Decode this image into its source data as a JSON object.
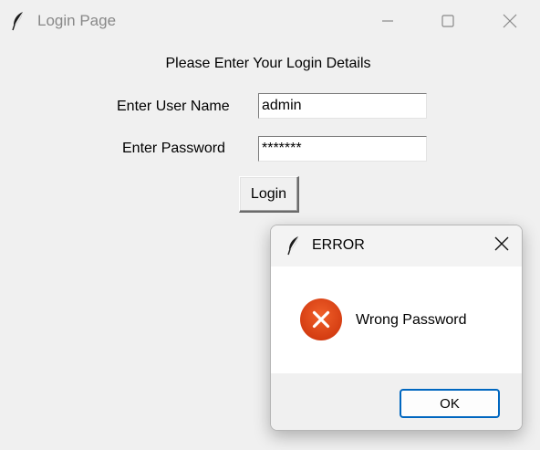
{
  "window": {
    "title": "Login Page",
    "app_icon": "feather-icon",
    "controls": [
      "minimize-icon",
      "maximize-icon",
      "close-icon"
    ]
  },
  "form": {
    "heading": "Please Enter Your Login Details",
    "username_label": "Enter User Name",
    "username_value": "admin",
    "password_label": "Enter Password",
    "password_value": "*******",
    "login_label": "Login"
  },
  "dialog": {
    "title": "ERROR",
    "icon": "error-icon",
    "message": "Wrong Password",
    "ok_label": "OK",
    "error_color": "#e0471f",
    "accent_color": "#0067c0"
  }
}
